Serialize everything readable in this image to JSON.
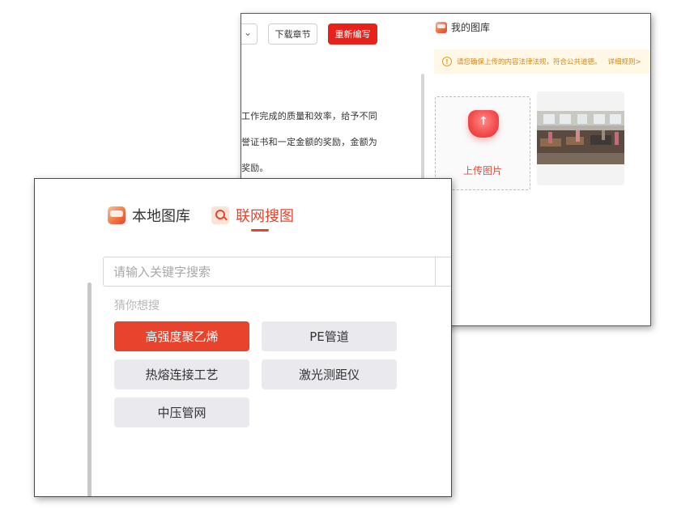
{
  "back_window": {
    "toolbar": {
      "download_label": "下载章节",
      "rewrite_label": "重新编写"
    },
    "document_lines": [
      "工作完成的质量和效率，给予不同",
      "誉证书和一定金额的奖励，金额为",
      "奖励。"
    ],
    "gallery": {
      "title": "我的图库",
      "notice_text": "请您确保上传的内容法律法规，符合公共道德。",
      "notice_link": "详细规则>",
      "upload_label": "上传图片"
    }
  },
  "front_window": {
    "tabs": [
      {
        "label": "本地图库",
        "icon": "local-gallery-icon",
        "active": false
      },
      {
        "label": "联网搜图",
        "icon": "search-icon",
        "active": true
      }
    ],
    "search": {
      "placeholder": "请输入关键字搜索",
      "value": ""
    },
    "suggestions": {
      "label": "猜你想搜",
      "items": [
        "高强度聚乙烯",
        "PE管道",
        "热熔连接工艺",
        "激光测距仪",
        "中压管网"
      ],
      "selected_index": 0
    }
  },
  "colors": {
    "accent": "#e8442d",
    "rewrite_button": "#e8221b",
    "notice_bg": "#fff8e6",
    "notice_text": "#d28a1a",
    "chip_bg": "#e9e9ee"
  }
}
